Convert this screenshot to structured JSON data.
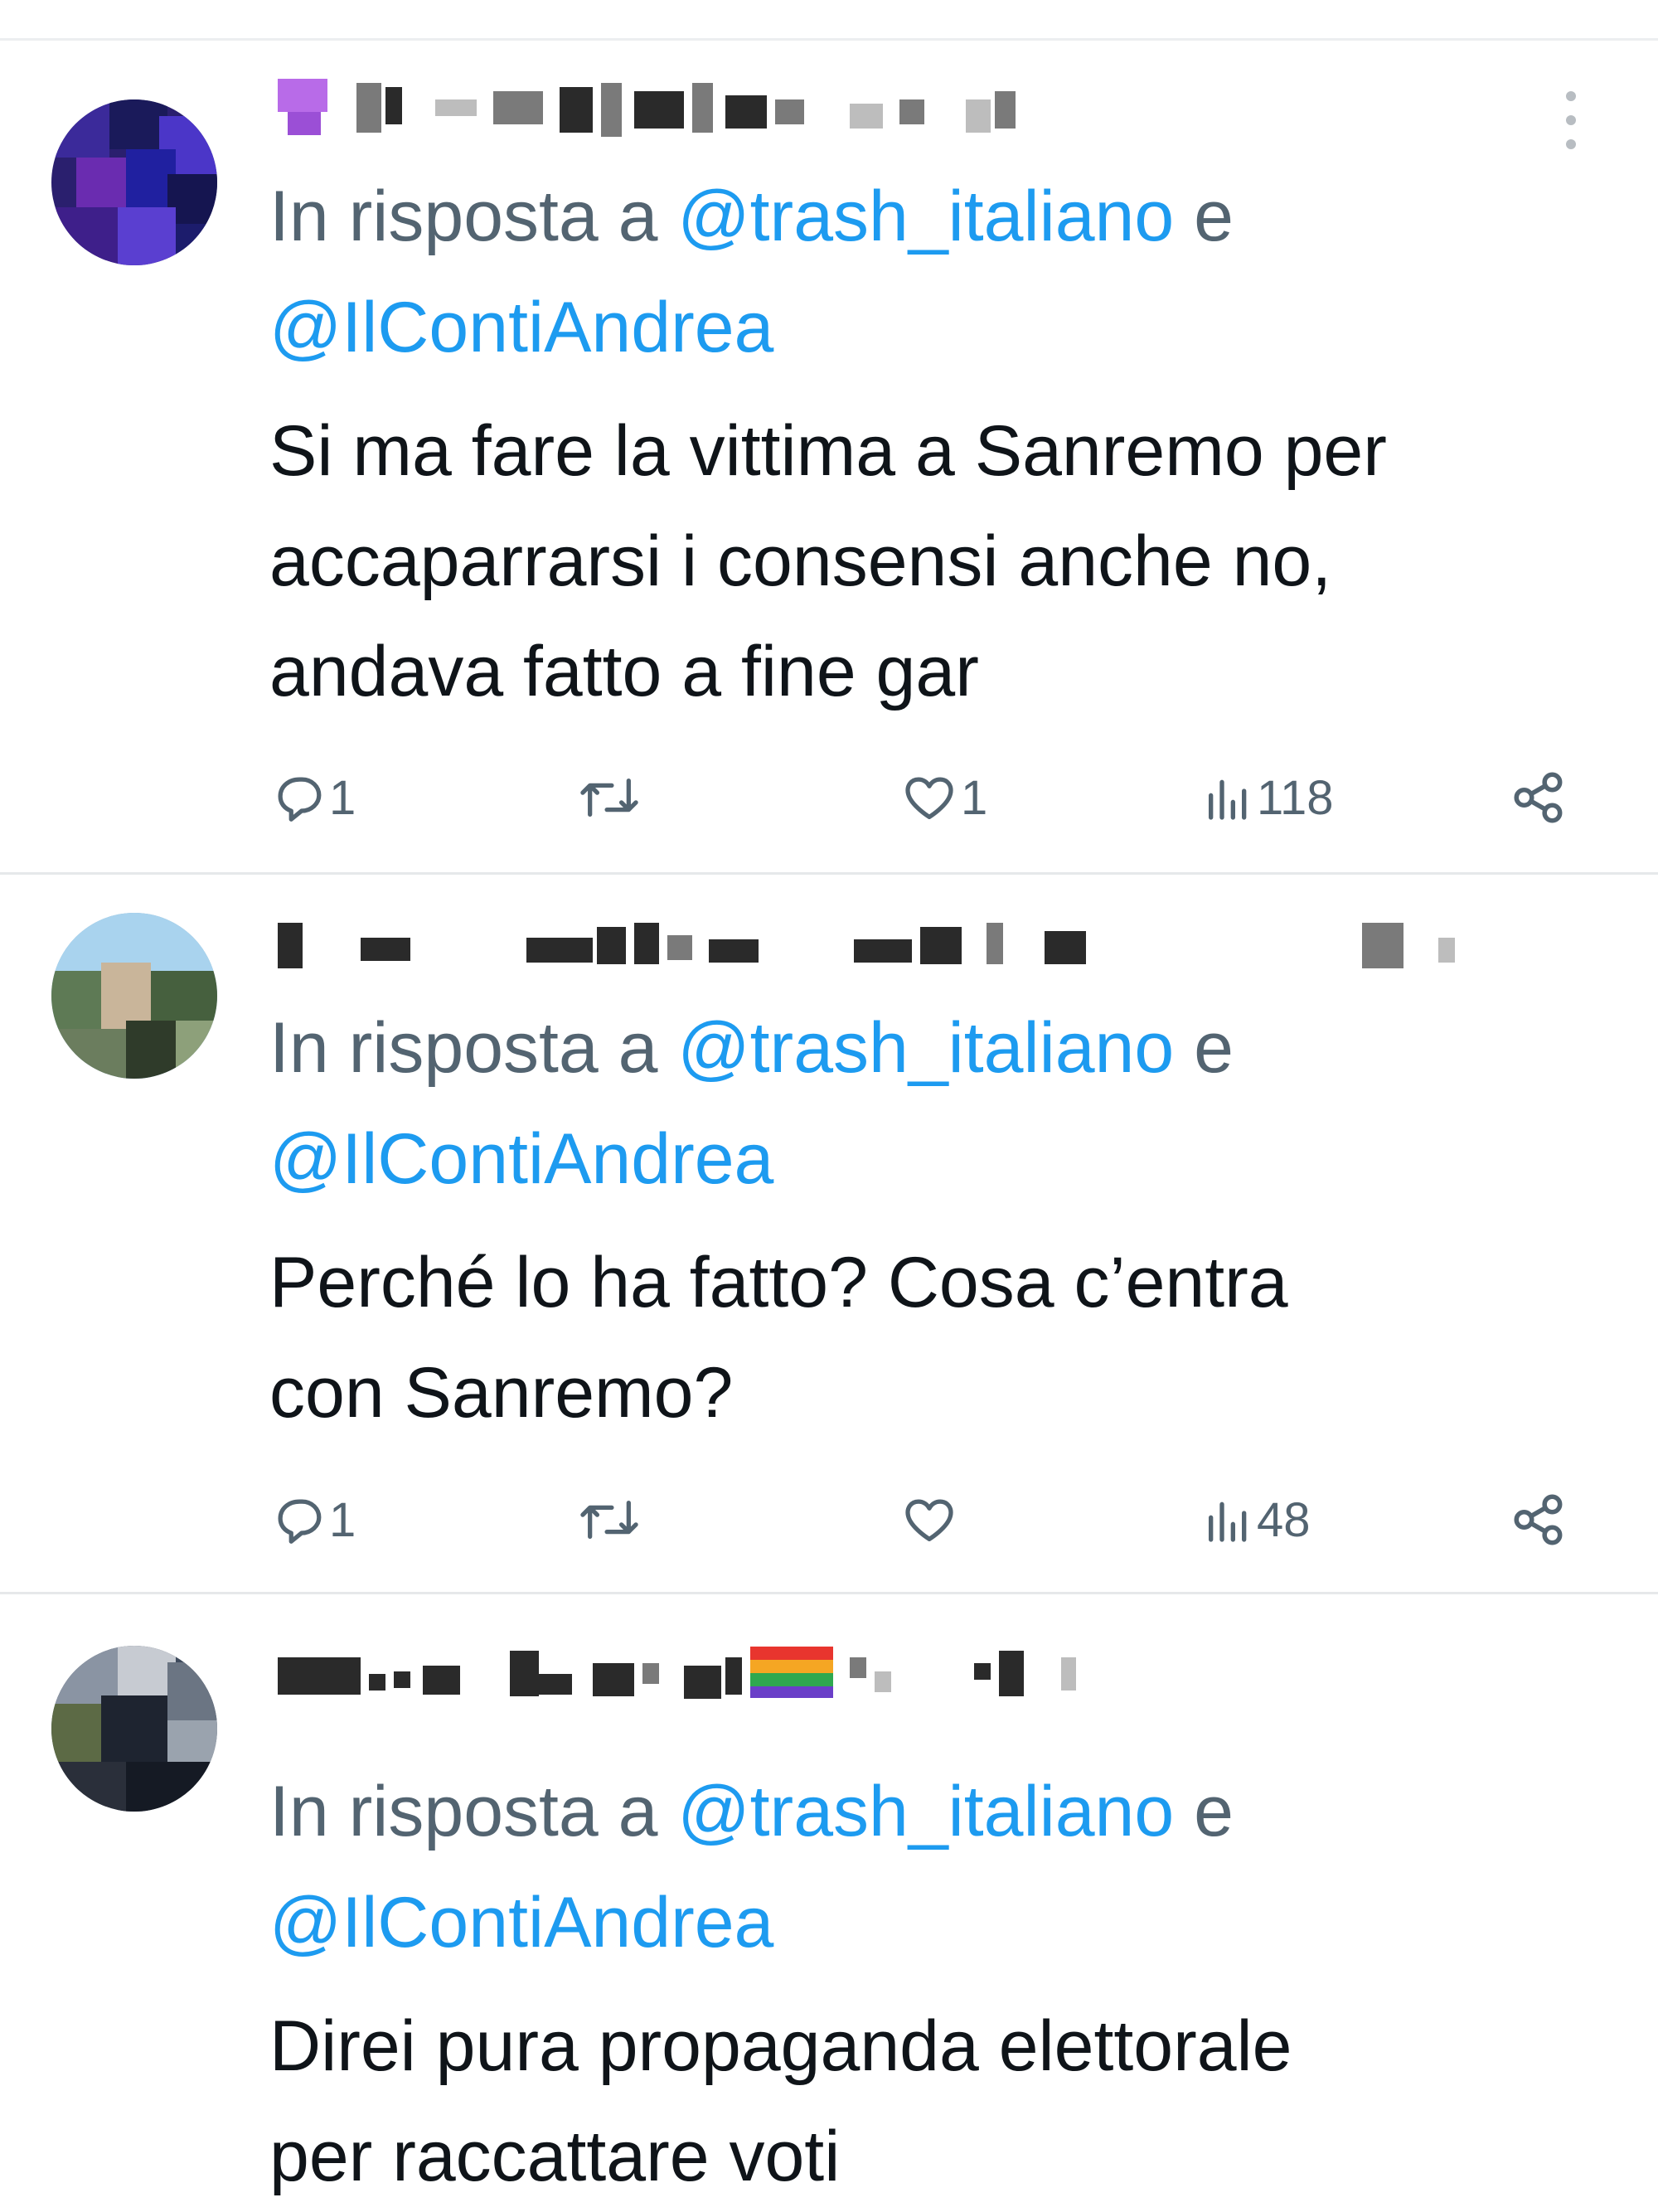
{
  "tweets": [
    {
      "reply_prefix": "In risposta a ",
      "mention_1": "@trash_italiano",
      "conj": " e",
      "mention_2": "@IlContiAndrea",
      "text": "Si ma fare la vittima a Sanremo per\naccaparrarsi i consensi anche no,\nandava fatto a fine gar",
      "reply_count": "1",
      "retweet_count": "",
      "like_count": "1",
      "views": "118",
      "icons": [
        "reply-icon",
        "retweet-icon",
        "like-icon",
        "views-icon",
        "share-icon",
        "more-icon"
      ]
    },
    {
      "reply_prefix": "In risposta a ",
      "mention_1": "@trash_italiano",
      "conj": " e",
      "mention_2": "@IlContiAndrea",
      "text": "Perché lo ha fatto? Cosa c’entra\ncon Sanremo?",
      "reply_count": "1",
      "retweet_count": "",
      "like_count": "",
      "views": "48",
      "icons": [
        "reply-icon",
        "retweet-icon",
        "like-icon",
        "views-icon",
        "share-icon"
      ]
    },
    {
      "reply_prefix": "In risposta a ",
      "mention_1": "@trash_italiano",
      "conj": " e",
      "mention_2": "@IlContiAndrea",
      "text": "Direi pura propaganda elettorale\nper raccattare voti"
    }
  ],
  "colors": {
    "text": "#0f1419",
    "secondary": "#536471",
    "link": "#1d9bf0",
    "divider": "#e6e8ea"
  }
}
